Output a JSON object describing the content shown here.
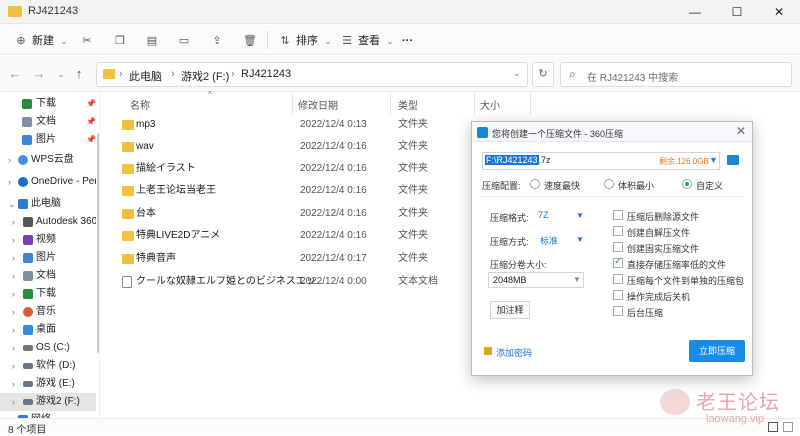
{
  "window": {
    "title": "RJ421243",
    "controls": [
      "—",
      "☐",
      "✕"
    ]
  },
  "toolbar": {
    "new_label": "新建",
    "sort_label": "排序",
    "view_label": "查看",
    "more_label": "···"
  },
  "address": {
    "segments": [
      "此电脑",
      "游戏2 (F:)",
      "RJ421243"
    ],
    "search_placeholder": "在 RJ421243 中搜索"
  },
  "sidebar": {
    "items": [
      {
        "label": "下载",
        "pinned": true
      },
      {
        "label": "文档",
        "pinned": true
      },
      {
        "label": "图片",
        "pinned": true
      },
      {
        "label": "WPS云盘"
      },
      {
        "label": "OneDrive - Perso"
      },
      {
        "label": "此电脑"
      },
      {
        "label": "Autodesk 360"
      },
      {
        "label": "视频"
      },
      {
        "label": "图片"
      },
      {
        "label": "文档"
      },
      {
        "label": "下载"
      },
      {
        "label": "音乐"
      },
      {
        "label": "桌面"
      },
      {
        "label": "OS (C:)"
      },
      {
        "label": "软件 (D:)"
      },
      {
        "label": "游戏 (E:)"
      },
      {
        "label": "游戏2 (F:)"
      },
      {
        "label": "网络"
      }
    ]
  },
  "columns": {
    "name": "名称",
    "date": "修改日期",
    "type": "类型",
    "size": "大小"
  },
  "files": [
    {
      "name": "mp3",
      "date": "2022/12/4 0:13",
      "type": "文件夹"
    },
    {
      "name": "wav",
      "date": "2022/12/4 0:16",
      "type": "文件夹"
    },
    {
      "name": "描絵イラスト",
      "date": "2022/12/4 0:16",
      "type": "文件夹"
    },
    {
      "name": "上老王论坛当老王",
      "date": "2022/12/4 0:16",
      "type": "文件夹"
    },
    {
      "name": "台本",
      "date": "2022/12/4 0:16",
      "type": "文件夹"
    },
    {
      "name": "特典LIVE2Dアニメ",
      "date": "2022/12/4 0:16",
      "type": "文件夹"
    },
    {
      "name": "特典音声",
      "date": "2022/12/4 0:17",
      "type": "文件夹"
    },
    {
      "name": "クールな奴隷エルフ姫とのビジネスエッ...",
      "date": "2022/12/4 0:00",
      "type": "文本文档"
    }
  ],
  "status": {
    "count_text": "8 个项目"
  },
  "dialog": {
    "title": "您将创建一个压缩文件 - 360压缩",
    "path_selected": "F:\\RJ421243",
    "path_rest": ".7z",
    "remaining": "剩余:126.0GB",
    "config_label": "压缩配置:",
    "radio_options": [
      {
        "label": "速度最快",
        "checked": false
      },
      {
        "label": "体积最小",
        "checked": false
      },
      {
        "label": "自定义",
        "checked": true
      }
    ],
    "format_label": "压缩格式:",
    "format_value": "7Z",
    "method_label": "压缩方式:",
    "method_value": "标准",
    "volume_label": "压缩分卷大小:",
    "volume_value": "2048MB",
    "note_button": "加注释",
    "checkboxes": [
      {
        "label": "压缩后删除源文件",
        "checked": false
      },
      {
        "label": "创建自解压文件",
        "checked": false
      },
      {
        "label": "创建固实压缩文件",
        "checked": false
      },
      {
        "label": "直接存储压缩率低的文件",
        "checked": true
      },
      {
        "label": "压缩每个文件到单独的压缩包",
        "checked": false
      },
      {
        "label": "操作完成后关机",
        "checked": false
      },
      {
        "label": "后台压缩",
        "checked": false
      }
    ],
    "add_password": "添加密码",
    "compress_button": "立即压缩"
  },
  "watermark": {
    "text": "老王论坛",
    "sub": "laowang.vip"
  },
  "colors": {
    "accent": "#1a8ce8",
    "folder": "#f0c13a",
    "check": "#2ba83a",
    "remaining": "#e67422"
  }
}
